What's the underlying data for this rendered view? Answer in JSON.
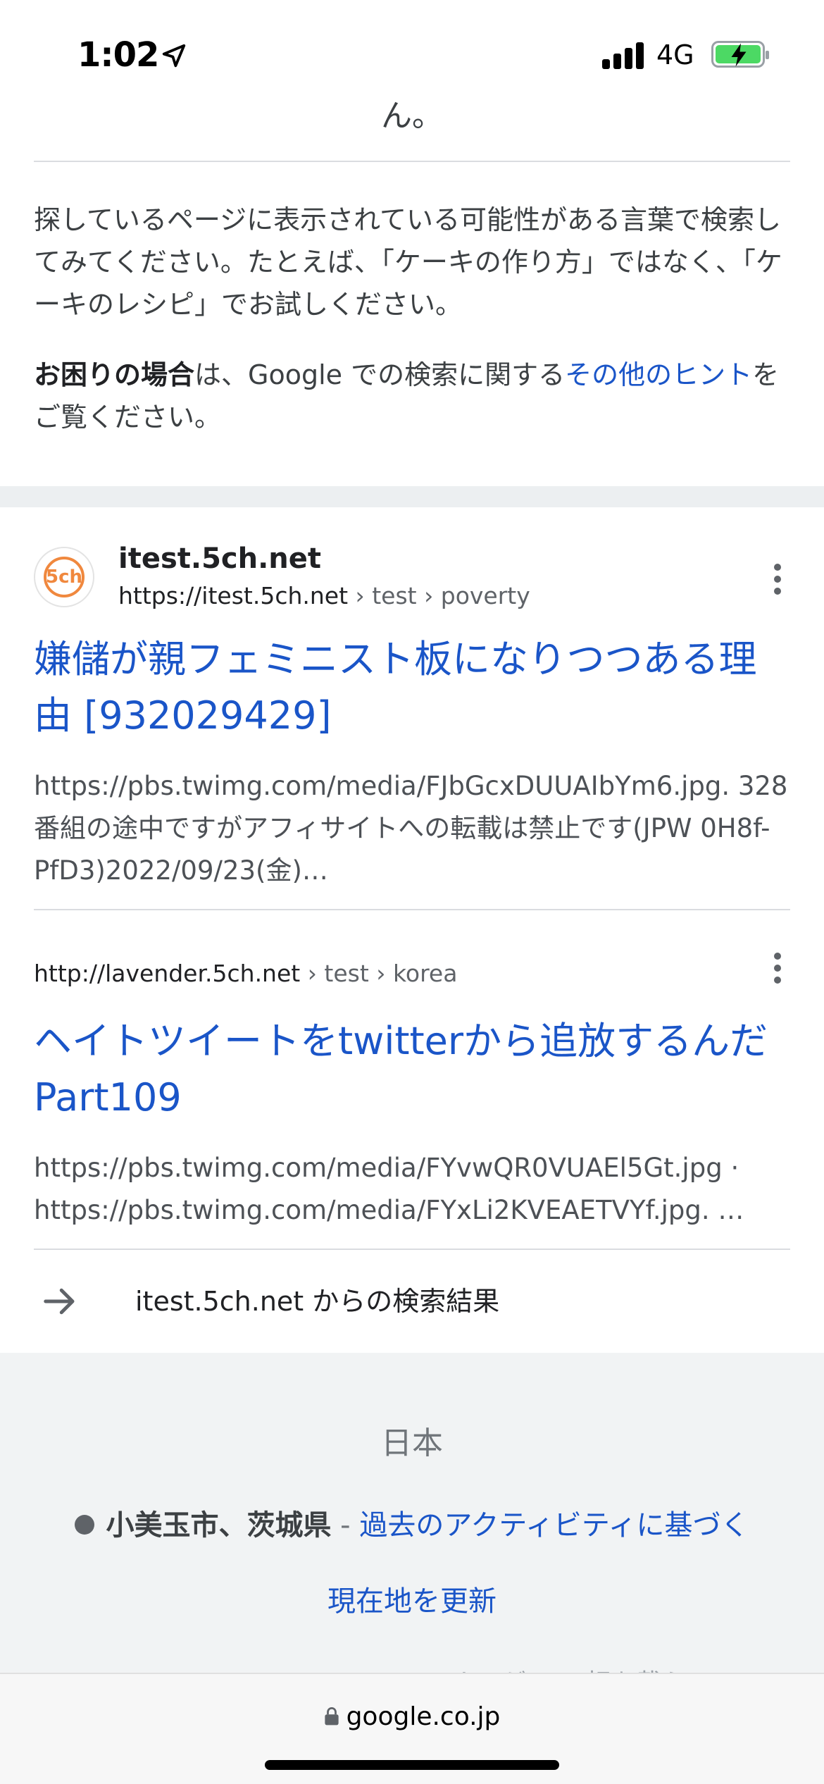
{
  "status_bar": {
    "time": "1:02",
    "network": "4G"
  },
  "trail_text": "ん。",
  "tip1": "探しているページに表示されている可能性がある言葉で検索してみてください。たとえば、「ケーキの作り方」ではなく、「ケーキのレシピ」でお試しください。",
  "tip2": {
    "bold": "お困りの場合",
    "mid": "は、Google での検索に関する",
    "link": "その他のヒント",
    "end": "をご覧ください。"
  },
  "result1": {
    "site_name": "itest.5ch.net",
    "url_base": "https://itest.5ch.net",
    "crumbs": " › test › poverty",
    "title": "嫌儲が親フェミニスト板になりつつある理由 [932029429]",
    "snippet": "https://pbs.twimg.com/media/FJbGcxDUUAIbYm6.jpg. 328番組の途中ですがアフィサイトへの転載は禁止です(JPW 0H8f-PfD3)2022/09/23(金)…"
  },
  "result2": {
    "url_base": "http://lavender.5ch.net",
    "crumbs": " › test › korea",
    "title": "ヘイトツイートをtwitterから追放するんだ Part109",
    "snippet": "https://pbs.twimg.com/media/FYvwQR0VUAEl5Gt.jpg · https://pbs.twimg.com/media/FYxLi2KVEAETVYf.jpg. …"
  },
  "more_results": "itest.5ch.net からの検索結果",
  "footer": {
    "country": "日本",
    "location": "小美玉市、茨城県",
    "separator": " - ",
    "location_source": "過去のアクティビティに基づく",
    "update_link": "現在地を更新",
    "partial_text": "ナルゲ ハの相を載ら"
  },
  "bottom_bar": {
    "url": "google.co.jp"
  },
  "colors": {
    "link": "#1a55c8",
    "favicon_accent": "#f0883e",
    "battery": "#4cd964"
  },
  "icons": [
    "location-arrow-icon",
    "signal-icon",
    "battery-icon",
    "favicon-icon",
    "more-vert-icon",
    "arrow-right-icon",
    "lock-icon"
  ]
}
